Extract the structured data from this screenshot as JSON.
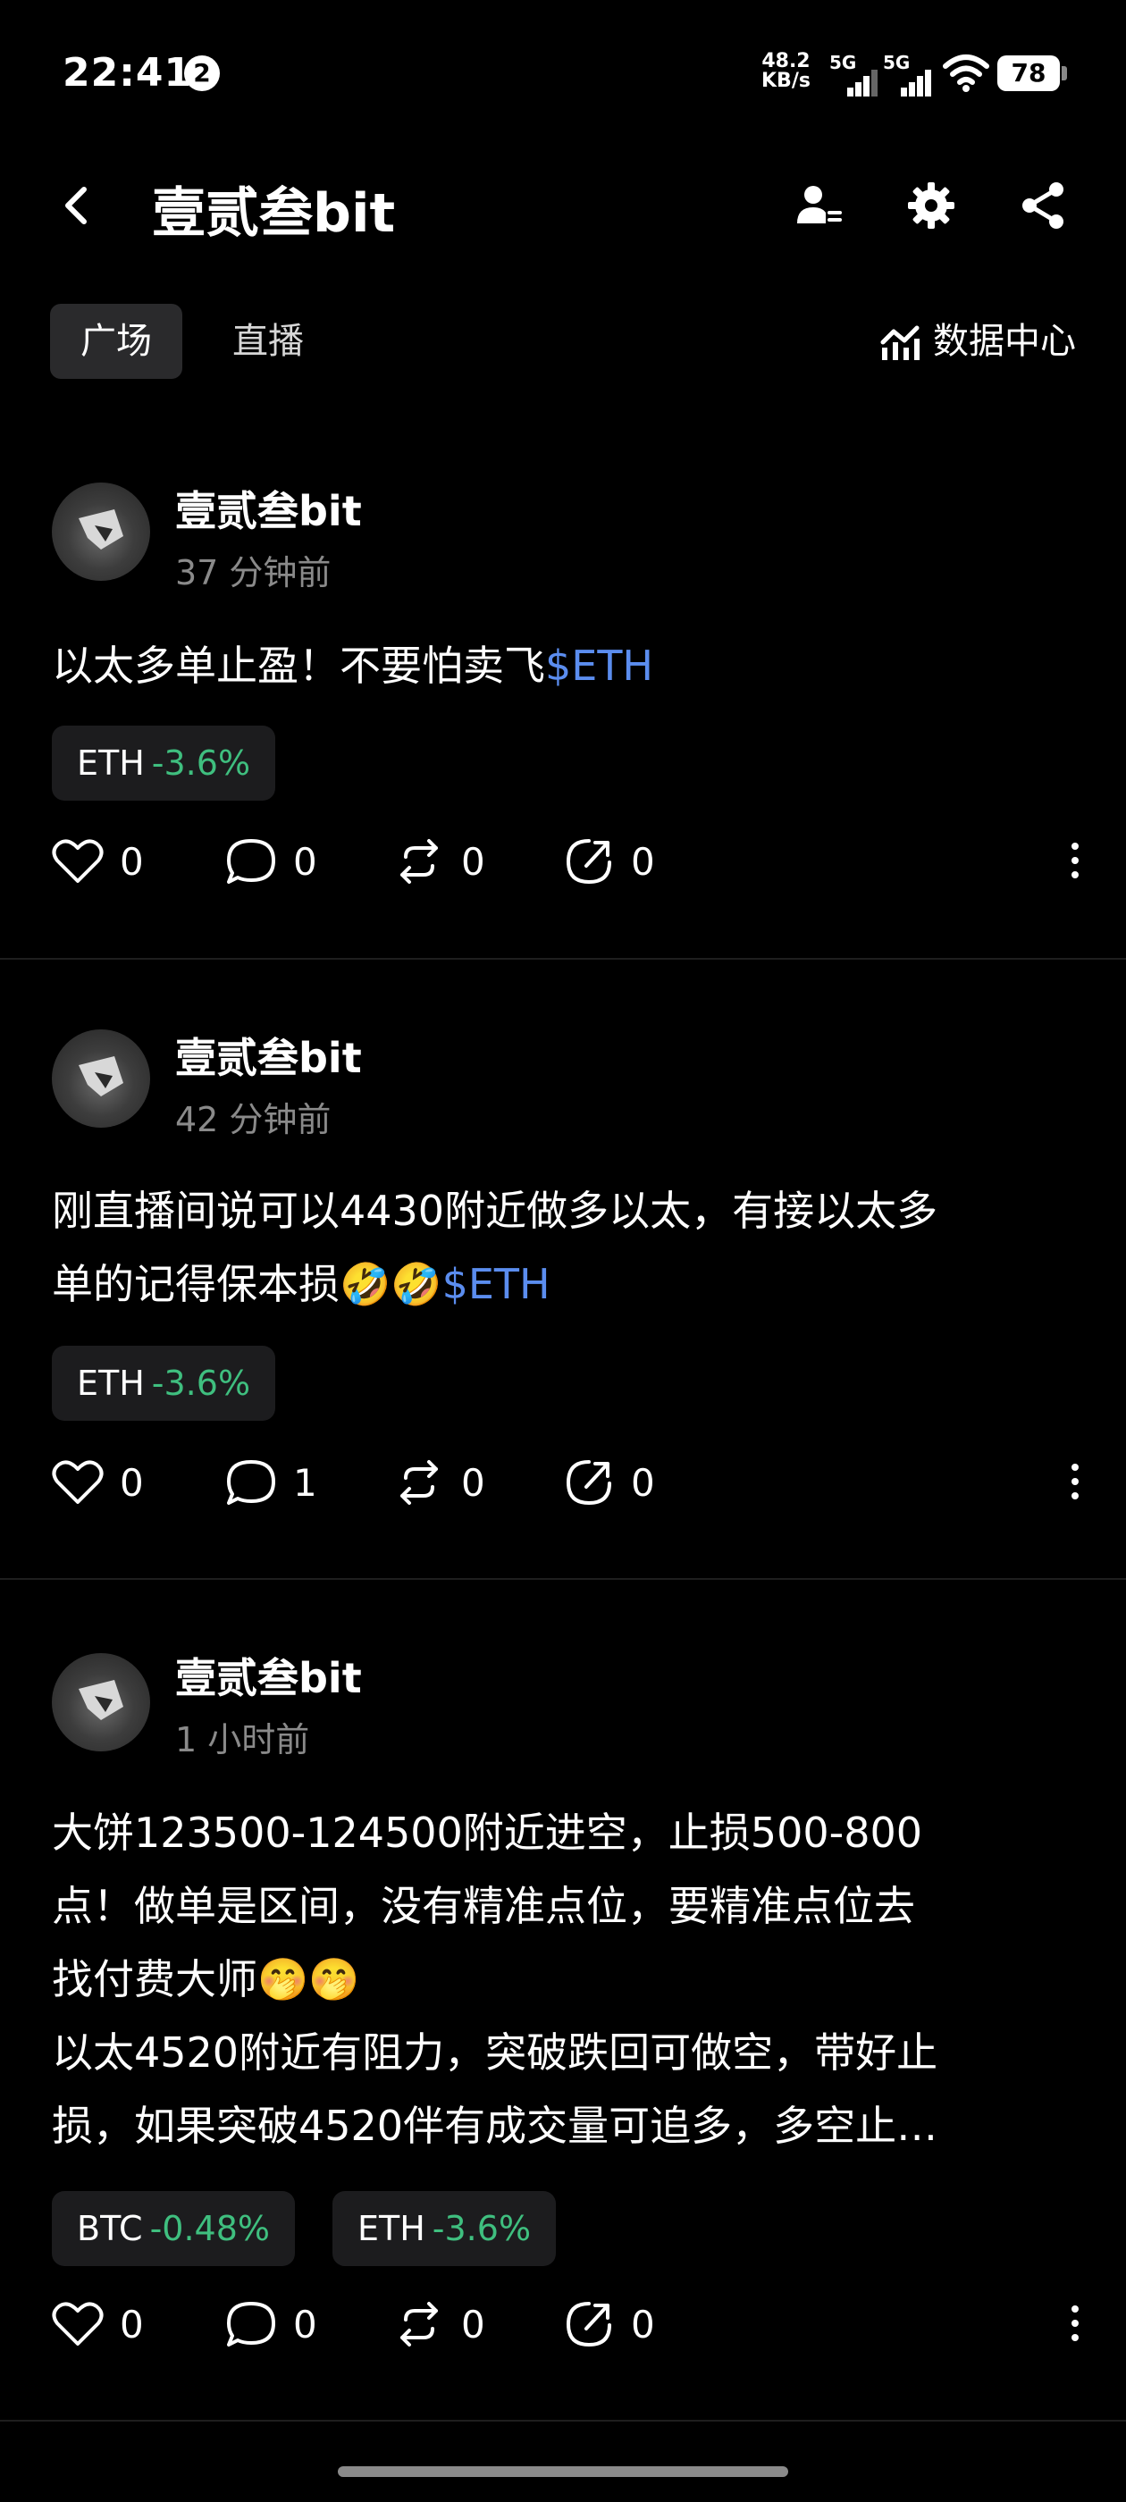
{
  "status_bar": {
    "time": "22:41",
    "notification_count": "2",
    "net_speed_value": "48.2",
    "net_speed_unit": "KB/s",
    "signal1_label": "5G",
    "signal2_label": "5G",
    "battery": "78"
  },
  "header": {
    "title": "壹贰叁bit",
    "icons": [
      "back-icon",
      "user-settings-icon",
      "gear-icon",
      "share-icon"
    ]
  },
  "tabs": [
    {
      "label": "广场",
      "active": true
    },
    {
      "label": "直播",
      "active": false
    }
  ],
  "data_center_label": "数据中心",
  "posts": [
    {
      "author": "壹贰叁bit",
      "time_ago": "37 分钟前",
      "text": "以太多单止盈！不要怕卖飞",
      "tag": "$ETH",
      "pills": [
        {
          "symbol": "ETH",
          "change": "-3.6%"
        }
      ],
      "likes": "0",
      "comments": "0",
      "reposts": "0",
      "shares": "0"
    },
    {
      "author": "壹贰叁bit",
      "time_ago": "42 分钟前",
      "text_line1": "刚直播间说可以4430附近做多以太，有接以太多",
      "text_line2": "单的记得保本损🤣🤣",
      "tag": "$ETH",
      "pills": [
        {
          "symbol": "ETH",
          "change": "-3.6%"
        }
      ],
      "likes": "0",
      "comments": "1",
      "reposts": "0",
      "shares": "0"
    },
    {
      "author": "壹贰叁bit",
      "time_ago": "1 小时前",
      "lines": [
        "大饼123500-124500附近进空，止损500-800",
        "点！做单是区间，没有精准点位，要精准点位去",
        "找付费大师🤭🤭",
        "以太4520附近有阻力，突破跌回可做空，带好止",
        "损，如果突破4520伴有成交量可追多，多空止…"
      ],
      "pills": [
        {
          "symbol": "BTC",
          "change": "-0.48%"
        },
        {
          "symbol": "ETH",
          "change": "-3.6%"
        }
      ],
      "likes": "0",
      "comments": "0",
      "reposts": "0",
      "shares": "0"
    }
  ]
}
